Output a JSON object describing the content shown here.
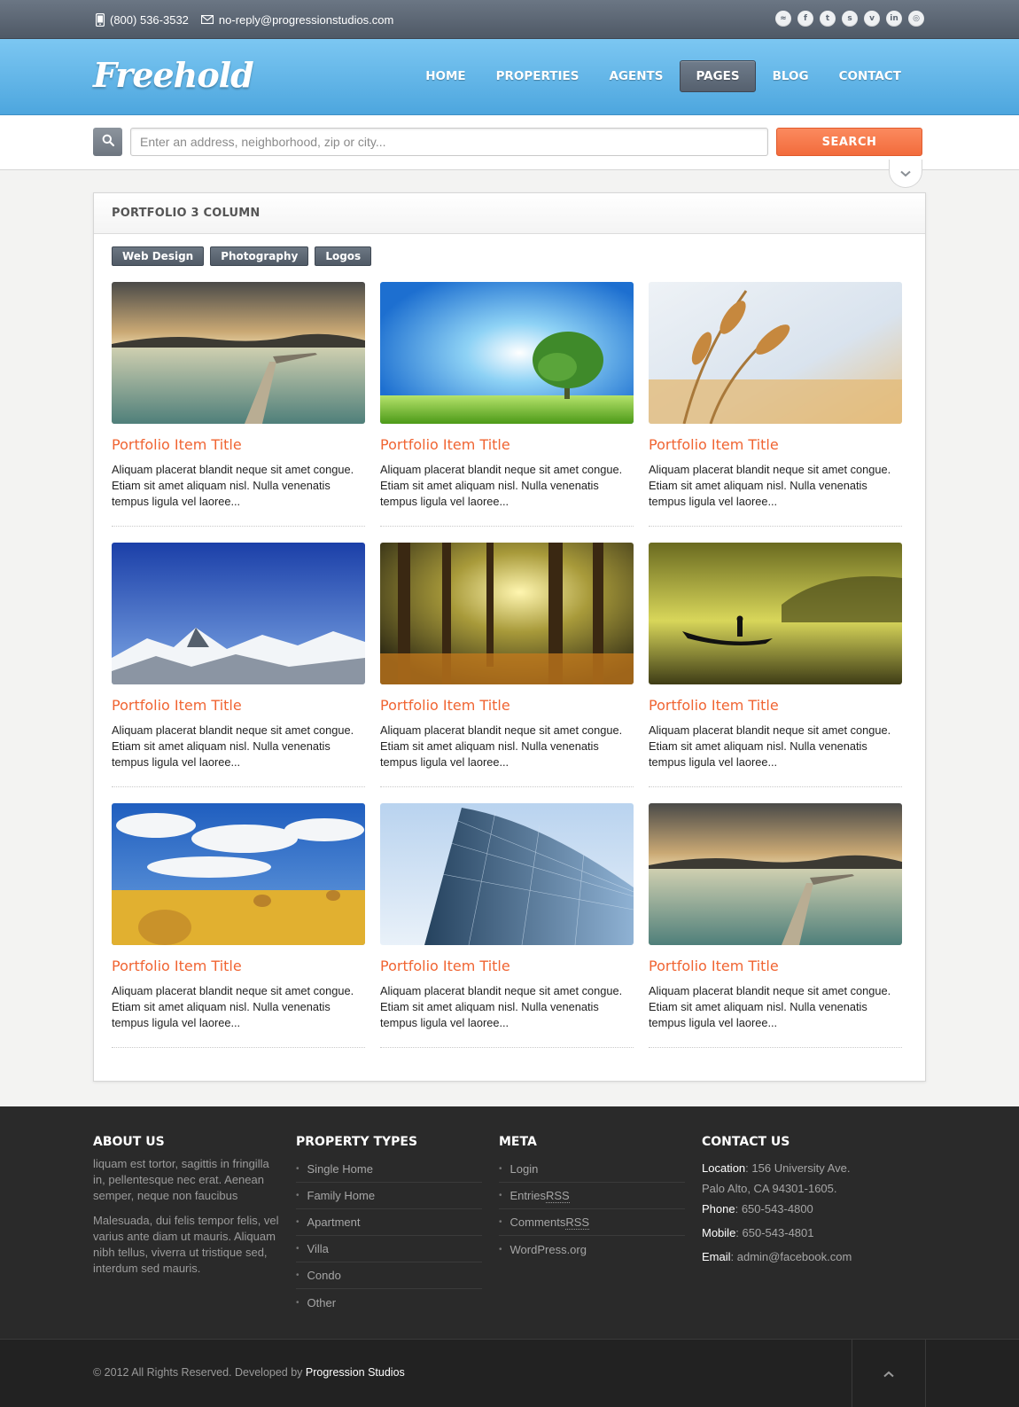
{
  "topbar": {
    "phone": "(800) 536-3532",
    "email": "no-reply@progressionstudios.com",
    "socials": [
      {
        "icon": "rss-icon",
        "glyph": "≈"
      },
      {
        "icon": "facebook-icon",
        "glyph": "f"
      },
      {
        "icon": "twitter-icon",
        "glyph": "t"
      },
      {
        "icon": "skype-icon",
        "glyph": "s"
      },
      {
        "icon": "vimeo-icon",
        "glyph": "v"
      },
      {
        "icon": "linkedin-icon",
        "glyph": "in"
      },
      {
        "icon": "dribbble-icon",
        "glyph": "◎"
      }
    ]
  },
  "header": {
    "logo": "Freehold",
    "nav": [
      {
        "label": "HOME",
        "active": false
      },
      {
        "label": "PROPERTIES",
        "active": false
      },
      {
        "label": "AGENTS",
        "active": false
      },
      {
        "label": "PAGES",
        "active": true
      },
      {
        "label": "BLOG",
        "active": false
      },
      {
        "label": "CONTACT",
        "active": false
      }
    ]
  },
  "search": {
    "placeholder": "Enter an address, neighborhood, zip or city...",
    "button": "SEARCH"
  },
  "portfolio": {
    "title": "PORTFOLIO 3 COLUMN",
    "filters": [
      "Web Design",
      "Photography",
      "Logos"
    ],
    "items": [
      {
        "title": "Portfolio Item Title",
        "desc": "Aliquam placerat blandit neque sit amet congue. Etiam sit amet aliquam nisl. Nulla venenatis tempus ligula vel laoree...",
        "image": "sunset-pier"
      },
      {
        "title": "Portfolio Item Title",
        "desc": "Aliquam placerat blandit neque sit amet congue. Etiam sit amet aliquam nisl. Nulla venenatis tempus ligula vel laoree...",
        "image": "tree-meadow"
      },
      {
        "title": "Portfolio Item Title",
        "desc": "Aliquam placerat blandit neque sit amet congue. Etiam sit amet aliquam nisl. Nulla venenatis tempus ligula vel laoree...",
        "image": "wheat"
      },
      {
        "title": "Portfolio Item Title",
        "desc": "Aliquam placerat blandit neque sit amet congue. Etiam sit amet aliquam nisl. Nulla venenatis tempus ligula vel laoree...",
        "image": "snowy-mountains"
      },
      {
        "title": "Portfolio Item Title",
        "desc": "Aliquam placerat blandit neque sit amet congue. Etiam sit amet aliquam nisl. Nulla venenatis tempus ligula vel laoree...",
        "image": "forest"
      },
      {
        "title": "Portfolio Item Title",
        "desc": "Aliquam placerat blandit neque sit amet congue. Etiam sit amet aliquam nisl. Nulla venenatis tempus ligula vel laoree...",
        "image": "fisherman-boat"
      },
      {
        "title": "Portfolio Item Title",
        "desc": "Aliquam placerat blandit neque sit amet congue. Etiam sit amet aliquam nisl. Nulla venenatis tempus ligula vel laoree...",
        "image": "hay-field"
      },
      {
        "title": "Portfolio Item Title",
        "desc": "Aliquam placerat blandit neque sit amet congue. Etiam sit amet aliquam nisl. Nulla venenatis tempus ligula vel laoree...",
        "image": "glass-building"
      },
      {
        "title": "Portfolio Item Title",
        "desc": "Aliquam placerat blandit neque sit amet congue. Etiam sit amet aliquam nisl. Nulla venenatis tempus ligula vel laoree...",
        "image": "sunset-pier"
      }
    ]
  },
  "footer": {
    "about": {
      "heading": "ABOUT US",
      "para1": "liquam est tortor, sagittis in fringilla in, pellentesque nec erat. Aenean semper, neque non faucibus",
      "para2": "Malesuada, dui felis tempor felis, vel varius ante diam ut mauris. Aliquam nibh tellus, viverra ut tristique sed, interdum sed mauris."
    },
    "property_types": {
      "heading": "PROPERTY TYPES",
      "items": [
        "Single Home",
        "Family Home",
        "Apartment",
        "Villa",
        "Condo",
        "Other"
      ]
    },
    "meta": {
      "heading": "META",
      "items": [
        {
          "pre": "Login",
          "rss": ""
        },
        {
          "pre": "Entries ",
          "rss": "RSS"
        },
        {
          "pre": "Comments ",
          "rss": "RSS"
        },
        {
          "pre": "WordPress.org",
          "rss": ""
        }
      ]
    },
    "contact": {
      "heading": "CONTACT US",
      "location_label": "Location",
      "location_line1": "156 University Ave.",
      "location_line2": "Palo Alto, CA 94301-1605.",
      "phone_label": "Phone",
      "phone": "650-543-4800",
      "mobile_label": "Mobile",
      "mobile": "650-543-4801",
      "email_label": "Email",
      "email": "admin@facebook.com"
    }
  },
  "bottom": {
    "copyright": "© 2012 All Rights Reserved. Developed by ",
    "developer": "Progression Studios"
  },
  "colors": {
    "accent": "#f26b3c",
    "header_blue": "#5fb4e8",
    "topbar": "#5c6672",
    "footer": "#2a2a2a"
  }
}
